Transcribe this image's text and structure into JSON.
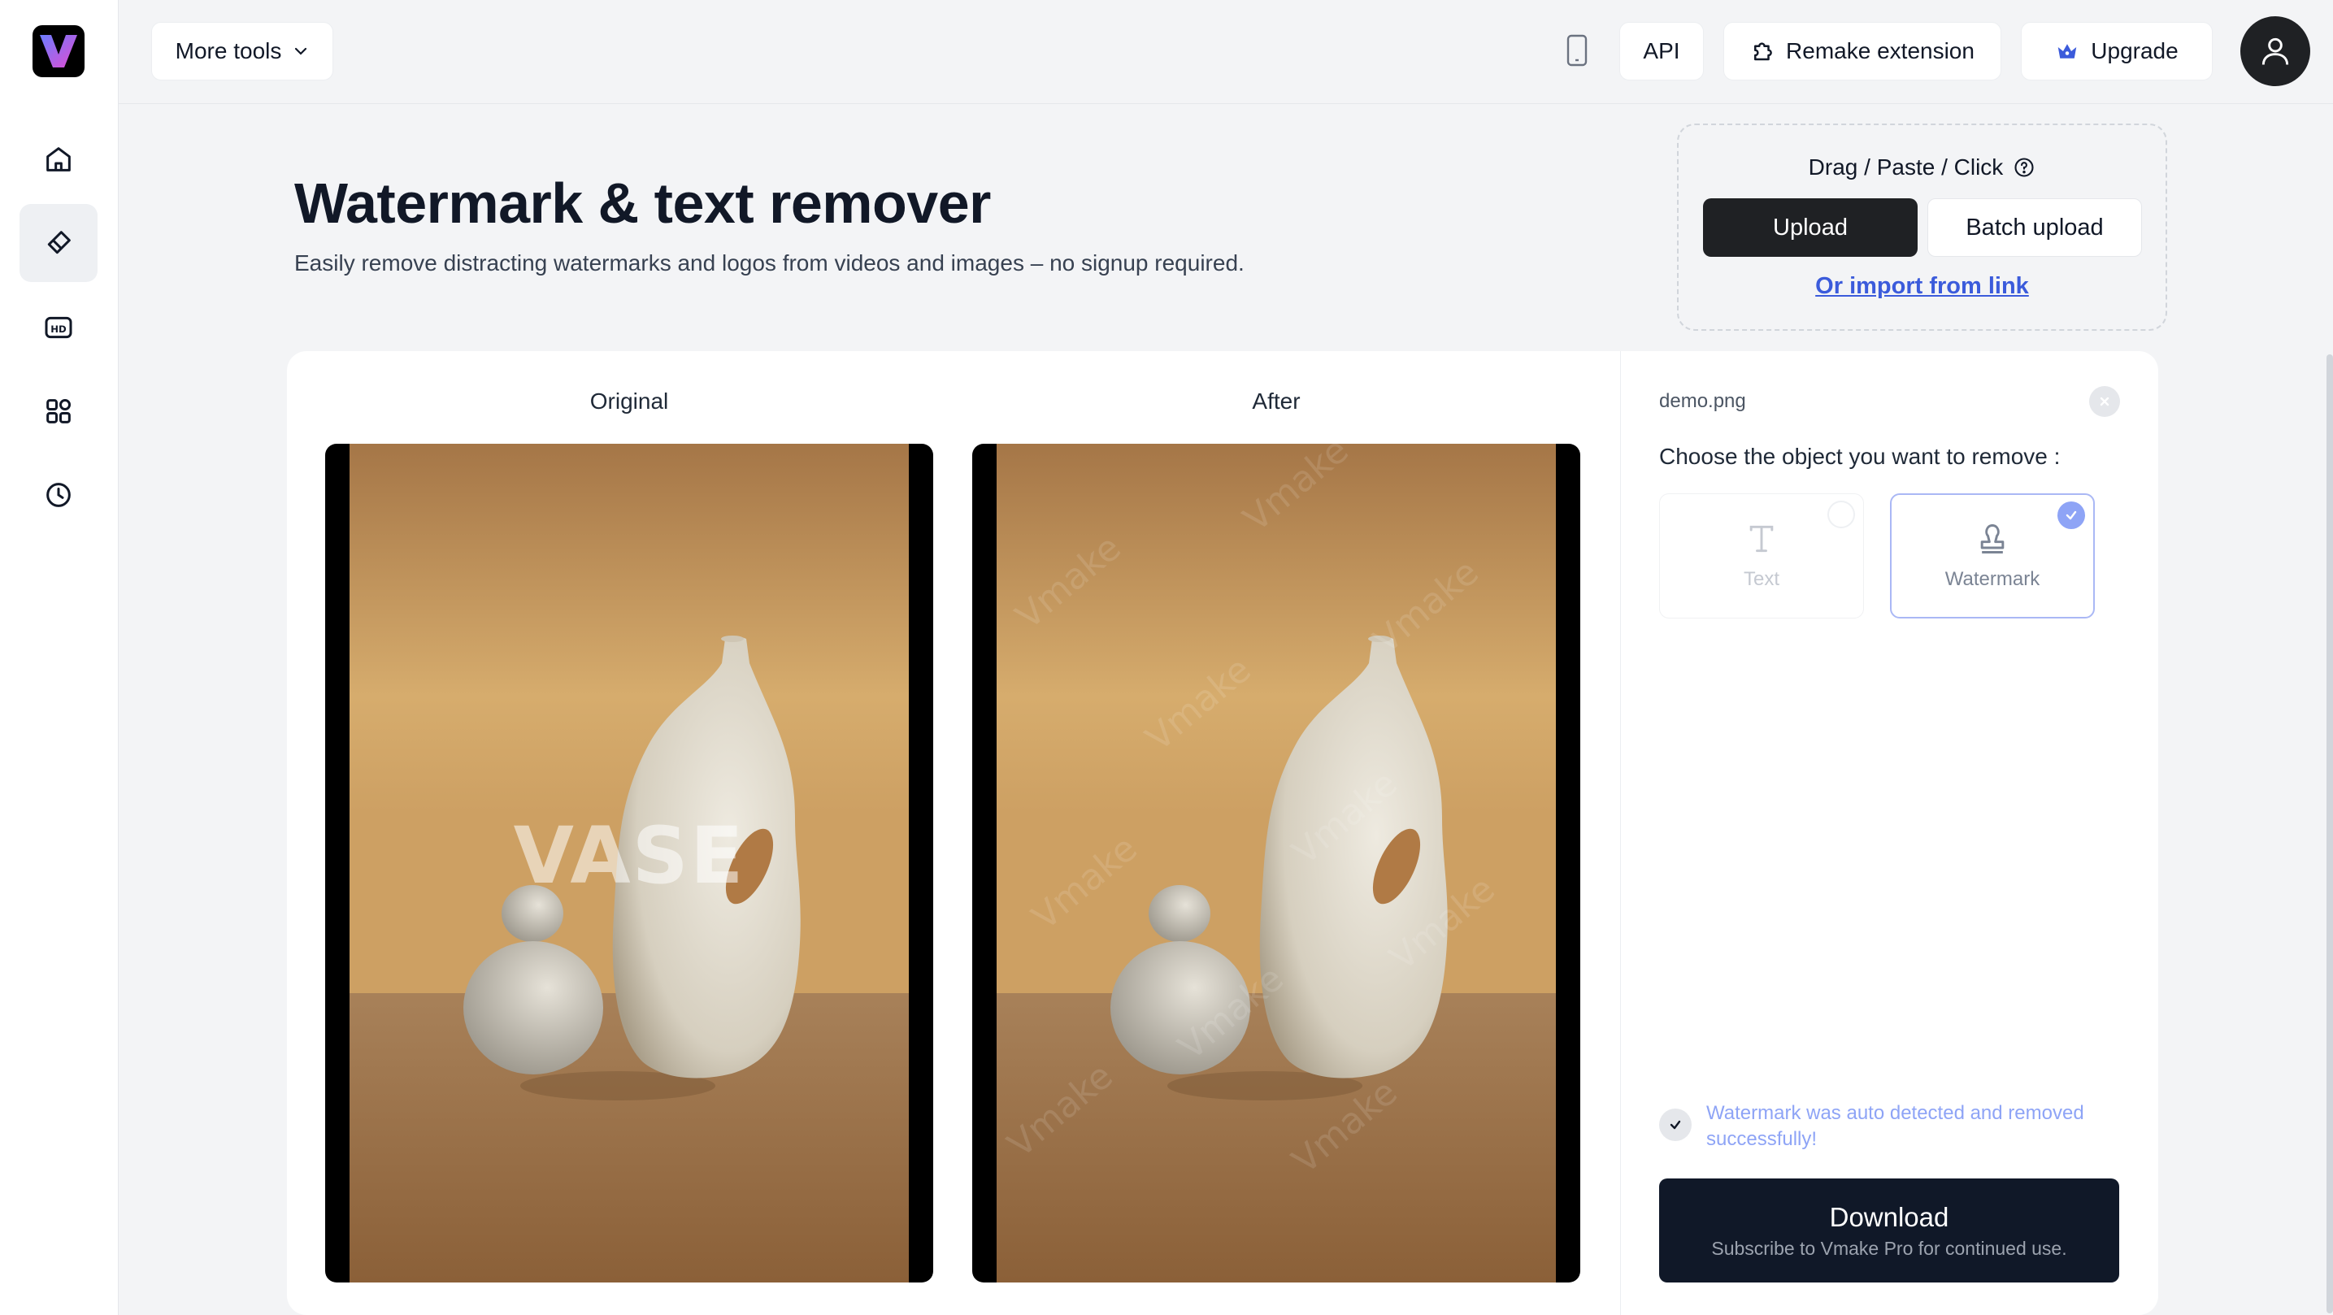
{
  "header": {
    "more_tools_label": "More tools",
    "api_label": "API",
    "remake_label": "Remake extension",
    "upgrade_label": "Upgrade"
  },
  "sidebar": {
    "items": [
      {
        "name": "home"
      },
      {
        "name": "eraser",
        "active": true
      },
      {
        "name": "hd"
      },
      {
        "name": "apps"
      },
      {
        "name": "history"
      }
    ]
  },
  "page": {
    "title": "Watermark & text remover",
    "subtitle": "Easily remove distracting watermarks and logos from videos and images – no signup required."
  },
  "upload": {
    "title": "Drag / Paste / Click",
    "upload_label": "Upload",
    "batch_label": "Batch upload",
    "import_label": "Or import from link"
  },
  "compare": {
    "original_label": "Original",
    "after_label": "After",
    "image_text": "VASE",
    "after_watermark": "Vmake"
  },
  "editor": {
    "filename": "demo.png",
    "choose_label": "Choose the object you want to remove :",
    "options": [
      {
        "label": "Text",
        "selected": false
      },
      {
        "label": "Watermark",
        "selected": true
      }
    ],
    "success_message": "Watermark was auto detected and removed successfully!",
    "download_label": "Download",
    "download_sub": "Subscribe to Vmake Pro for continued use."
  },
  "colors": {
    "accent": "#3b5bdb",
    "primary_dark": "#1f2124",
    "download_bg": "#101828",
    "success_text": "#8ea4f6"
  }
}
